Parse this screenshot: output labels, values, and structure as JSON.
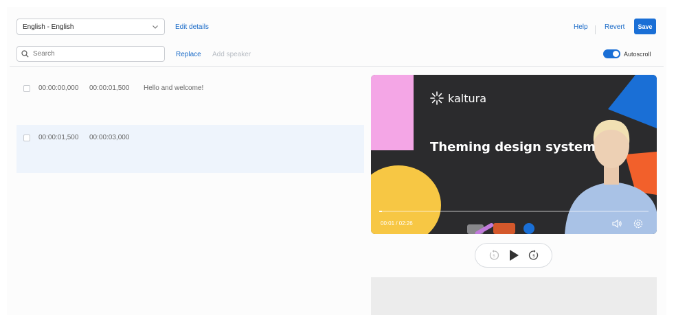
{
  "toolbar": {
    "language": "English - English",
    "edit_details": "Edit details",
    "help": "Help",
    "revert": "Revert",
    "save": "Save",
    "search_placeholder": "Search",
    "replace": "Replace",
    "add_speaker": "Add speaker",
    "autoscroll_label": "Autoscroll",
    "autoscroll_on": true
  },
  "transcript": [
    {
      "start": "00:00:00,000",
      "end": "00:00:01,500",
      "text": "Hello and welcome!"
    },
    {
      "start": "00:00:01,500",
      "end": "00:00:03,000",
      "text": ""
    }
  ],
  "video": {
    "brand": "kaltura",
    "slide_title": "Theming design system",
    "time": "00:01 / 02:26",
    "progress": 0.007
  },
  "colors": {
    "accent": "#1a6fd6",
    "selected_row": "#eef4fc",
    "slide_pink": "#f4a6e6",
    "slide_yellow": "#f7c744",
    "slide_blue": "#1a6fd6",
    "slide_orange": "#f2602b"
  },
  "icons": {
    "dropdown": "chevron-down-icon",
    "search": "search-icon",
    "volume": "volume-icon",
    "settings": "gear-icon",
    "rewind": "rewind-5-icon",
    "play": "play-icon",
    "forward": "forward-5-icon"
  }
}
